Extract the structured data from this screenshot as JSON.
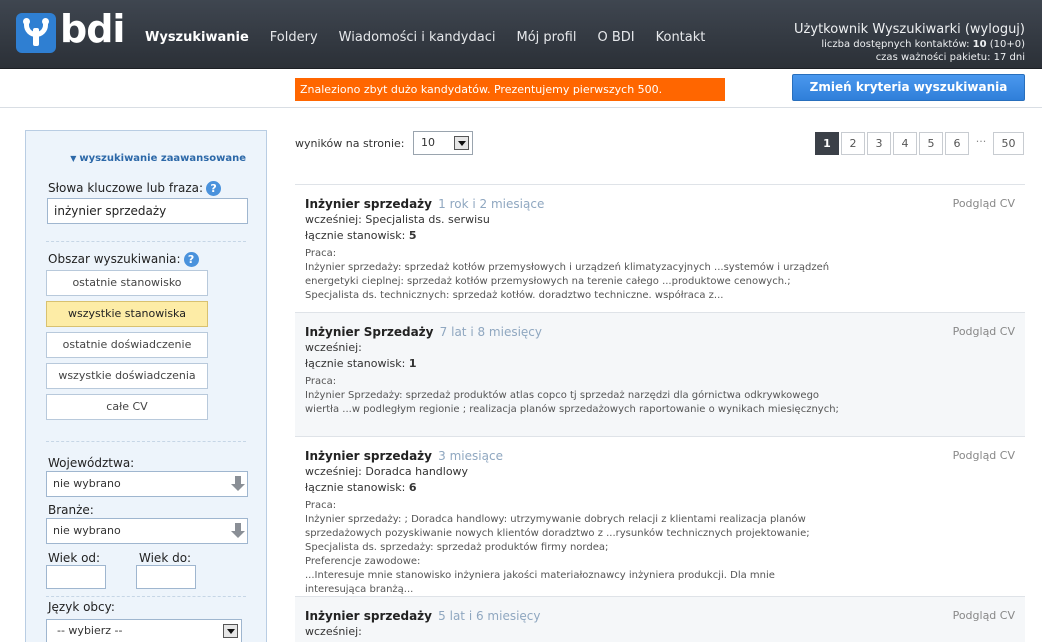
{
  "brand": {
    "name": "bdi"
  },
  "nav": [
    "Wyszukiwanie",
    "Foldery",
    "Wiadomości i kandydaci",
    "Mój profil",
    "O BDI",
    "Kontakt"
  ],
  "user": {
    "name": "Użytkownik Wyszukiwarki (wyloguj)",
    "contacts_label": "liczba dostępnych kontaktów: ",
    "contacts_value": "10",
    "contacts_extra": " (10+0)",
    "validity": "czas ważności pakietu: 17 dni"
  },
  "notice": "Znaleziono zbyt dużo kandydatów. Prezentujemy pierwszych 500.",
  "change_criteria": "Zmień kryteria wyszukiwania",
  "sidebar": {
    "advanced": "wyszukiwanie zaawansowane",
    "keywords_label": "Słowa kluczowe lub fraza:",
    "keywords_value": "inżynier sprzedaży",
    "area_label": "Obszar wyszukiwania:",
    "area_options": [
      "ostatnie stanowisko",
      "wszystkie stanowiska",
      "ostatnie doświadczenie",
      "wszystkie doświadczenia",
      "całe CV"
    ],
    "area_selected": 1,
    "voivodeship_label": "Województwa:",
    "voivodeship_value": "nie wybrano",
    "industry_label": "Branże:",
    "industry_value": "nie wybrano",
    "age_from_label": "Wiek od:",
    "age_to_label": "Wiek do:",
    "language_label": "Język obcy:",
    "language_value": "-- wybierz --"
  },
  "results_controls": {
    "perpage_label": "wyników na stronie:",
    "perpage_value": "10",
    "pages": [
      "1",
      "2",
      "3",
      "4",
      "5",
      "6",
      "···",
      "50"
    ],
    "active_page": "1"
  },
  "results": [
    {
      "title": "Inżynier sprzedaży",
      "duration": "1 rok i 2 miesiące",
      "cv": "Podgląd CV",
      "previously_label": "wcześniej:",
      "previously": "Specjalista ds. serwisu",
      "positions_label": "łącznie stanowisk:",
      "positions": "5",
      "work_label": "Praca:",
      "lines": [
        "Inżynier sprzedaży: sprzedaż kotłów przemysłowych i urządzeń klimatyzacyjnych ...systemów i urządzeń",
        "energetyki cieplnej: sprzedaż kotłów przemysłowych na terenie całego ...produktowe cenowych.;",
        "Specjalista ds. technicznych: sprzedaż kotłów. doradztwo techniczne. współraca z..."
      ]
    },
    {
      "title": "Inżynier Sprzedaży",
      "duration": "7 lat i 8 miesięcy",
      "cv": "Podgląd CV",
      "previously_label": "wcześniej:",
      "previously": "",
      "positions_label": "łącznie stanowisk:",
      "positions": "1",
      "work_label": "Praca:",
      "lines": [
        "Inżynier Sprzedaży: sprzedaż produktów atlas copco tj sprzedaż narzędzi dla górnictwa odkrywkowego",
        "wiertła ...w podległym regionie ; realizacja planów sprzedażowych raportowanie o wynikach miesięcznych;"
      ]
    },
    {
      "title": "Inżynier sprzedaży",
      "duration": "3 miesiące",
      "cv": "Podgląd CV",
      "previously_label": "wcześniej:",
      "previously": "Doradca handlowy",
      "positions_label": "łącznie stanowisk:",
      "positions": "6",
      "work_label": "Praca:",
      "lines": [
        "Inżynier sprzedaży: ; Doradca handlowy: utrzymywanie dobrych relacji z klientami realizacja planów",
        "sprzedażowych pozyskiwanie nowych klientów doradztwo z ...rysunków technicznych projektowanie;",
        "Specjalista ds. sprzedaży: sprzedaż produktów firmy nordea;",
        "Preferencje zawodowe:",
        "...Interesuje mnie stanowisko inżyniera jakości materiałoznawcy inżyniera produkcji. Dla mnie",
        "interesująca branżą..."
      ]
    },
    {
      "title": "Inżynier sprzedaży",
      "duration": "5 lat i 6 miesięcy",
      "cv": "Podgląd CV",
      "previously_label": "wcześniej:",
      "previously": "",
      "positions_label": "",
      "positions": "",
      "work_label": "",
      "lines": []
    }
  ]
}
